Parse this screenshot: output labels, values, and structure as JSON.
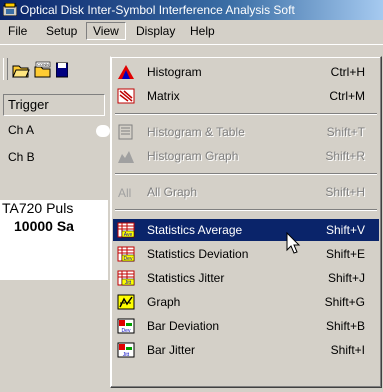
{
  "window": {
    "title": "Optical Disk Inter-Symbol Interference Analysis Soft"
  },
  "menubar": {
    "items": [
      "File",
      "Setup",
      "View",
      "Display",
      "Help"
    ],
    "active": "View"
  },
  "left_panel": {
    "trigger": "Trigger",
    "ch_a": "Ch A",
    "ch_b": "Ch B",
    "instrument": "TA720 Puls",
    "samples": "10000 Sa"
  },
  "view_menu": {
    "items": [
      {
        "label": "Histogram",
        "shortcut": "Ctrl+H",
        "icon": "histogram-icon",
        "enabled": true
      },
      {
        "label": "Matrix",
        "shortcut": "Ctrl+M",
        "icon": "matrix-icon",
        "enabled": true
      },
      {
        "label": "Histogram & Table",
        "shortcut": "Shift+T",
        "icon": "histogram-table-icon",
        "enabled": false
      },
      {
        "label": "Histogram Graph",
        "shortcut": "Shift+R",
        "icon": "histogram-graph-icon",
        "enabled": false
      },
      {
        "label": "All Graph",
        "shortcut": "Shift+H",
        "icon": "all-graph-icon",
        "enabled": false
      },
      {
        "label": "Statistics Average",
        "shortcut": "Shift+V",
        "icon": "statistics-average-icon",
        "enabled": true,
        "highlighted": true
      },
      {
        "label": "Statistics Deviation",
        "shortcut": "Shift+E",
        "icon": "statistics-deviation-icon",
        "enabled": true
      },
      {
        "label": "Statistics Jitter",
        "shortcut": "Shift+J",
        "icon": "statistics-jitter-icon",
        "enabled": true
      },
      {
        "label": "Graph",
        "shortcut": "Shift+G",
        "icon": "graph-icon",
        "enabled": true
      },
      {
        "label": "Bar Deviation",
        "shortcut": "Shift+B",
        "icon": "bar-deviation-icon",
        "enabled": true
      },
      {
        "label": "Bar Jitter",
        "shortcut": "Shift+I",
        "icon": "bar-jitter-icon",
        "enabled": true
      }
    ]
  },
  "colors": {
    "title_bar": "#0a246a",
    "highlight": "#0a246a",
    "face": "#d4d0c8"
  }
}
